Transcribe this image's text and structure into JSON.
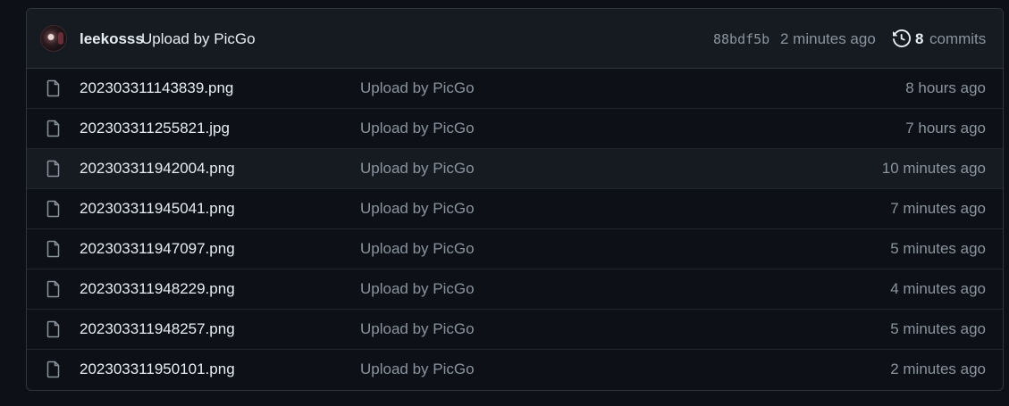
{
  "latest_commit": {
    "author": "leekosss",
    "message": "Upload by PicGo",
    "sha": "88bdf5b",
    "time": "2 minutes ago",
    "commits_count": "8",
    "commits_label": "commits"
  },
  "files": [
    {
      "name": "202303311143839.png",
      "message": "Upload by PicGo",
      "time": "8 hours ago"
    },
    {
      "name": "202303311255821.jpg",
      "message": "Upload by PicGo",
      "time": "7 hours ago"
    },
    {
      "name": "202303311942004.png",
      "message": "Upload by PicGo",
      "time": "10 minutes ago"
    },
    {
      "name": "202303311945041.png",
      "message": "Upload by PicGo",
      "time": "7 minutes ago"
    },
    {
      "name": "202303311947097.png",
      "message": "Upload by PicGo",
      "time": "5 minutes ago"
    },
    {
      "name": "202303311948229.png",
      "message": "Upload by PicGo",
      "time": "4 minutes ago"
    },
    {
      "name": "202303311948257.png",
      "message": "Upload by PicGo",
      "time": "5 minutes ago"
    },
    {
      "name": "202303311950101.png",
      "message": "Upload by PicGo",
      "time": "2 minutes ago"
    }
  ],
  "icons": {
    "file": "file-icon",
    "history": "history-icon",
    "avatar": "avatar"
  },
  "colors": {
    "background": "#0d1117",
    "header_bg": "#161b22",
    "border": "#30363d",
    "text_primary": "#e6edf3",
    "text_muted": "#8b949e"
  },
  "highlighted_row": 2
}
